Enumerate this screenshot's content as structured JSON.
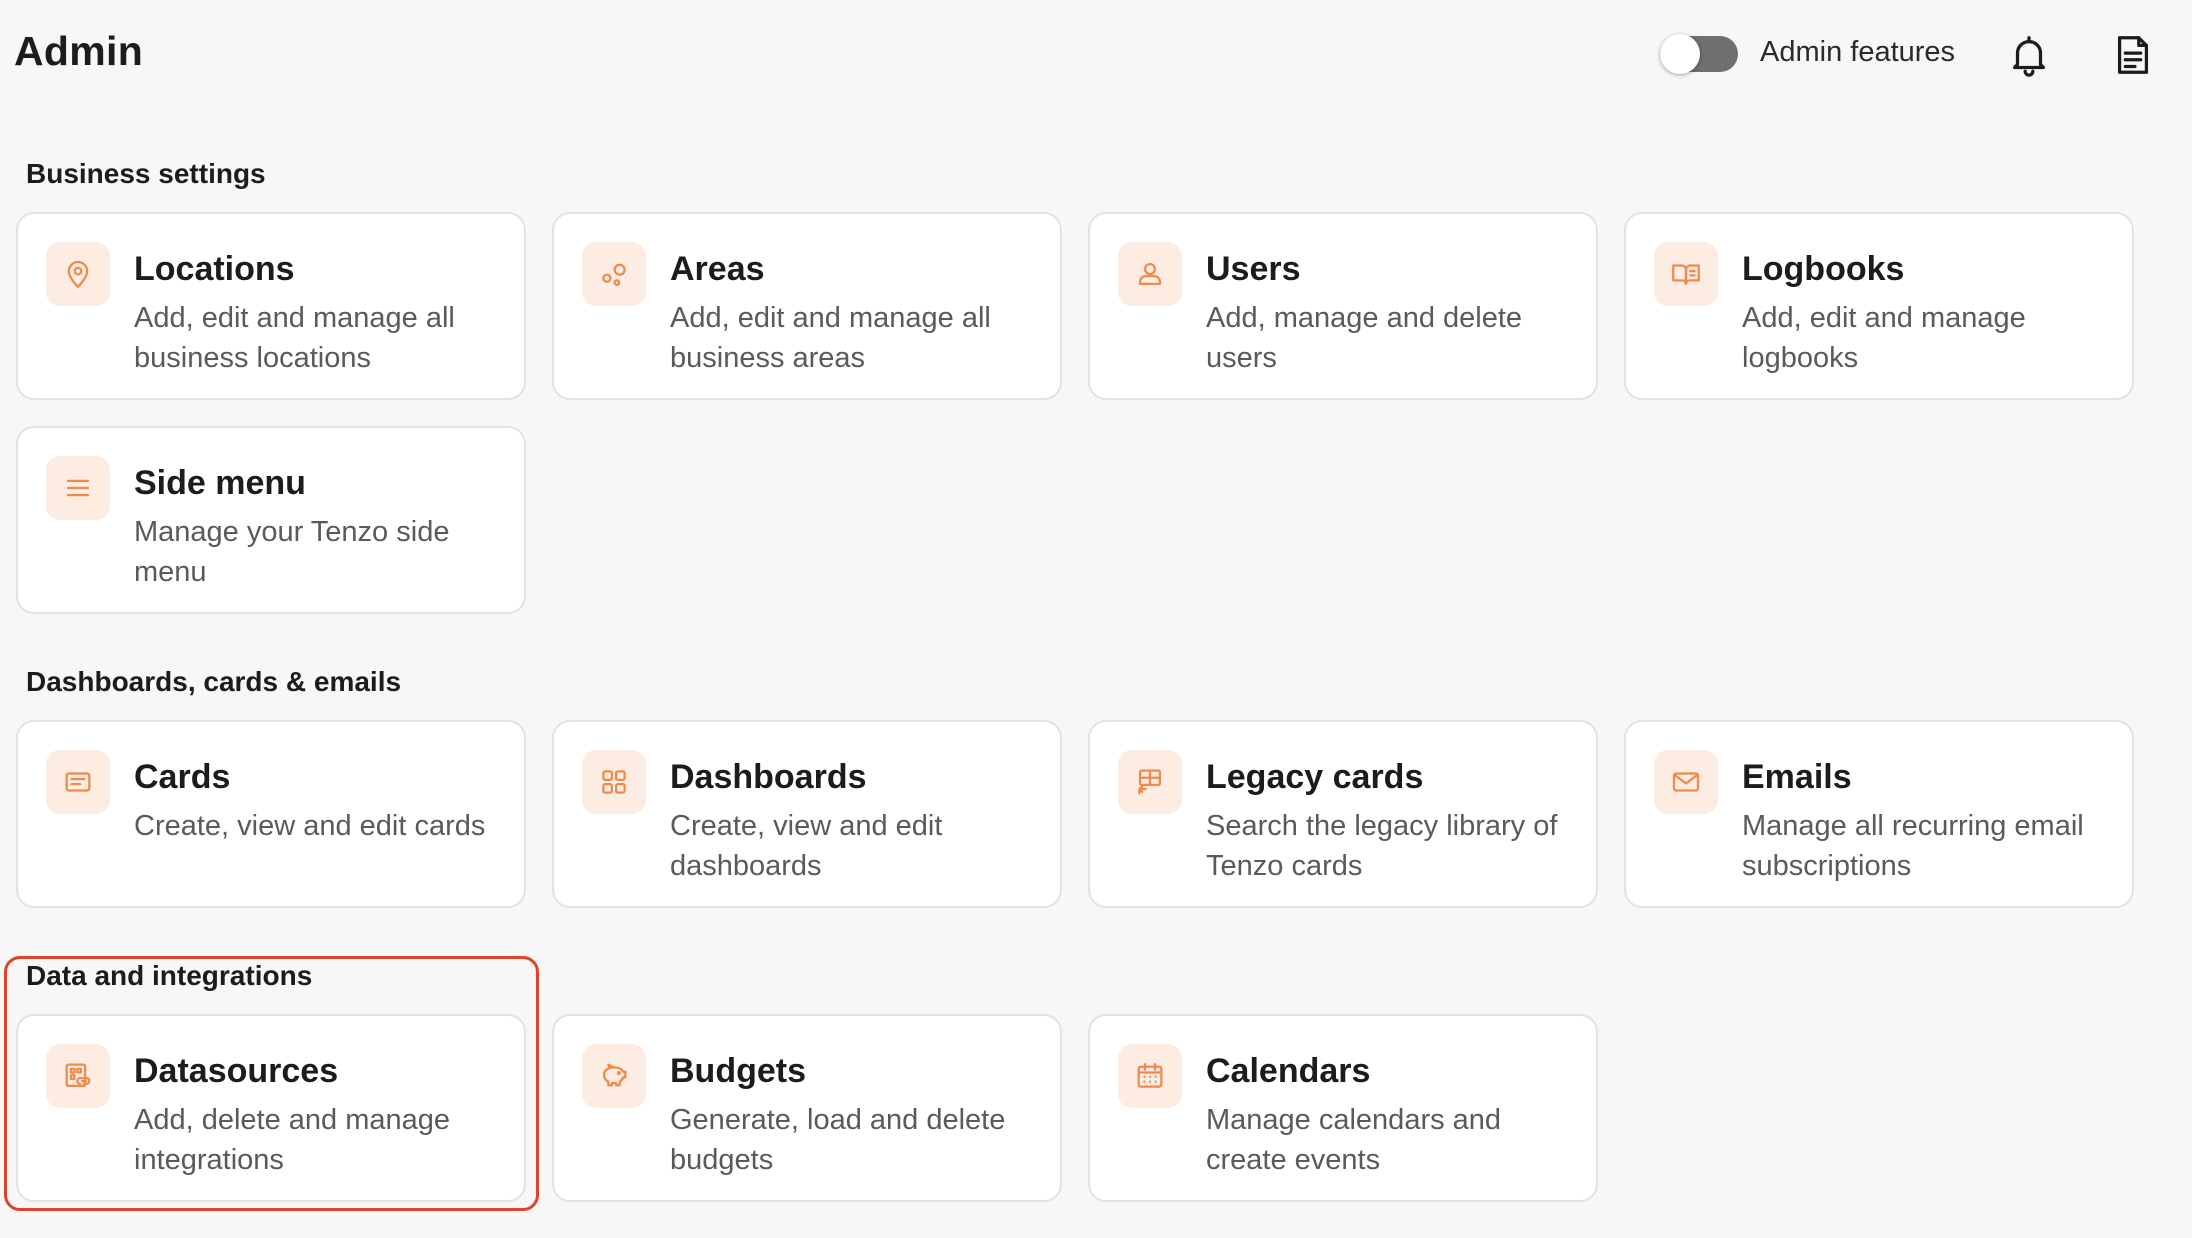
{
  "header": {
    "title": "Admin",
    "toggle_label": "Admin features",
    "toggle_on": false
  },
  "accent_color": "#f08a4b",
  "sections": [
    {
      "title": "Business settings",
      "cards": [
        {
          "title": "Locations",
          "desc": "Add, edit and manage all business locations",
          "icon": "location-pin-icon"
        },
        {
          "title": "Areas",
          "desc": "Add, edit and manage all business areas",
          "icon": "areas-icon"
        },
        {
          "title": "Users",
          "desc": "Add, manage and delete users",
          "icon": "user-icon"
        },
        {
          "title": "Logbooks",
          "desc": "Add, edit and manage logbooks",
          "icon": "book-icon"
        },
        {
          "title": "Side menu",
          "desc": "Manage your Tenzo side menu",
          "icon": "menu-icon"
        }
      ]
    },
    {
      "title": "Dashboards, cards & emails",
      "cards": [
        {
          "title": "Cards",
          "desc": "Create, view and edit cards",
          "icon": "card-icon"
        },
        {
          "title": "Dashboards",
          "desc": "Create, view and edit dashboards",
          "icon": "grid-icon"
        },
        {
          "title": "Legacy cards",
          "desc": "Search the legacy library of Tenzo cards",
          "icon": "legacy-card-icon"
        },
        {
          "title": "Emails",
          "desc": "Manage all recurring email subscriptions",
          "icon": "mail-icon"
        }
      ]
    },
    {
      "title": "Data and integrations",
      "cards": [
        {
          "title": "Datasources",
          "desc": "Add, delete and manage integrations",
          "icon": "datasource-icon"
        },
        {
          "title": "Budgets",
          "desc": "Generate, load and delete budgets",
          "icon": "piggy-bank-icon"
        },
        {
          "title": "Calendars",
          "desc": "Manage calendars and create events",
          "icon": "calendar-icon"
        }
      ]
    }
  ]
}
